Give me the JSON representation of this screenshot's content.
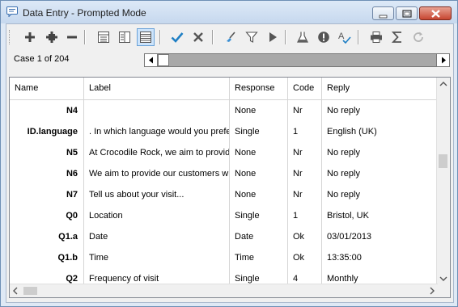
{
  "window": {
    "title": "Data Entry - Prompted Mode"
  },
  "icons": {
    "title": "speech-bubble-icon",
    "add": "plus-icon",
    "insert": "plus-cross-icon",
    "remove": "minus-icon",
    "form_view": "form-view-icon",
    "split_view": "split-view-icon",
    "grid_view": "grid-view-icon",
    "accept": "checkmark-icon",
    "cancel": "x-icon",
    "clear": "broom-icon",
    "filter": "filter-icon",
    "run": "play-icon",
    "test": "flask-icon",
    "validate": "exclamation-icon",
    "spell": "spellcheck-icon",
    "print": "printer-icon",
    "sum": "sigma-icon",
    "refresh": "refresh-icon"
  },
  "case": {
    "label": "Case 1 of 204",
    "position": 0.0
  },
  "columns": [
    "Name",
    "Label",
    "Response",
    "Code",
    "Reply"
  ],
  "rows": [
    {
      "name": "N4",
      "label": "",
      "response": "None",
      "code": "Nr",
      "reply": "No reply"
    },
    {
      "name": "ID.language",
      "label": ". In which language would you prefer",
      "response": "Single",
      "code": "1",
      "reply": "English (UK)"
    },
    {
      "name": "N5",
      "label": "At Crocodile Rock, we aim to provide",
      "response": "None",
      "code": "Nr",
      "reply": "No reply"
    },
    {
      "name": "N6",
      "label": "We aim to provide our customers with",
      "response": "None",
      "code": "Nr",
      "reply": "No reply"
    },
    {
      "name": "N7",
      "label": "Tell us about your visit...",
      "response": "None",
      "code": "Nr",
      "reply": "No reply"
    },
    {
      "name": "Q0",
      "label": "Location",
      "response": "Single",
      "code": "1",
      "reply": "Bristol, UK"
    },
    {
      "name": "Q1.a",
      "label": "Date",
      "response": "Date",
      "code": "Ok",
      "reply": "03/01/2013"
    },
    {
      "name": "Q1.b",
      "label": "Time",
      "response": "Time",
      "code": "Ok",
      "reply": "13:35:00"
    },
    {
      "name": "Q2",
      "label": "Frequency of visit",
      "response": "Single",
      "code": "4",
      "reply": "Monthly"
    }
  ]
}
